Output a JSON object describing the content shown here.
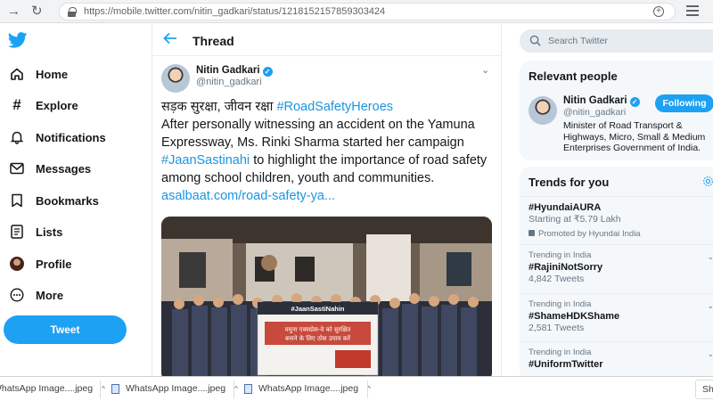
{
  "browser": {
    "url": "https://mobile.twitter.com/nitin_gadkari/status/1218152157859303424",
    "back_icon": "arrow-right-icon",
    "reload_icon": "reload-icon"
  },
  "sidebar": {
    "items": [
      {
        "label": "Home",
        "icon": "home-icon"
      },
      {
        "label": "Explore",
        "icon": "hashtag-icon"
      },
      {
        "label": "Notifications",
        "icon": "bell-icon"
      },
      {
        "label": "Messages",
        "icon": "envelope-icon"
      },
      {
        "label": "Bookmarks",
        "icon": "bookmark-icon"
      },
      {
        "label": "Lists",
        "icon": "list-icon"
      },
      {
        "label": "Profile",
        "icon": "avatar"
      },
      {
        "label": "More",
        "icon": "more-icon"
      }
    ],
    "tweet_button": "Tweet"
  },
  "thread": {
    "title": "Thread",
    "author_name": "Nitin Gadkari",
    "author_handle": "@nitin_gadkari",
    "text_hindi": "सड़क सुरक्षा, जीवन रक्षा",
    "hashtag1": "#RoadSafetyHeroes",
    "text1": "After personally witnessing an accident on the Yamuna Expressway, Ms. Rinki Sharma started her campaign",
    "hashtag2": "#JaanSastinahi",
    "text2": "to highlight the importance of road safety among school children, youth and communities.",
    "link": "asalbaat.com/road-safety-ya...",
    "banner_title": "#JaanSastiNahin",
    "banner_line1": "यमुना एक्सप्रेस-वे को सुरक्षित",
    "banner_line2": "बनाने के लिए ठोस उपाय करें"
  },
  "right": {
    "search_placeholder": "Search Twitter",
    "relevant_title": "Relevant people",
    "person_name": "Nitin Gadkari",
    "person_handle": "@nitin_gadkari",
    "follow_label": "Following",
    "person_bio": "Minister of Road Transport & Highways, Micro, Small & Medium Enterprises Government of India.",
    "trends_title": "Trends for you",
    "trends": [
      {
        "meta": "",
        "name": "#HyundaiAURA",
        "sub": "Starting at ₹5.79 Lakh",
        "promo": "Promoted by Hyundai India"
      },
      {
        "meta": "Trending in India",
        "name": "#RajiniNotSorry",
        "sub": "4,842 Tweets",
        "promo": ""
      },
      {
        "meta": "Trending in India",
        "name": "#ShameHDKShame",
        "sub": "2,581 Tweets",
        "promo": ""
      },
      {
        "meta": "Trending in India",
        "name": "#UniformTwitter",
        "sub": "",
        "promo": ""
      }
    ]
  },
  "downloads": {
    "items": [
      "WhatsApp Image....jpeg",
      "WhatsApp Image....jpeg",
      "WhatsApp Image....jpeg"
    ],
    "show_all": "Sh"
  },
  "colors": {
    "accent": "#1da1f2",
    "link": "#1b95e0",
    "text": "#14171a",
    "secondary": "#657786"
  }
}
